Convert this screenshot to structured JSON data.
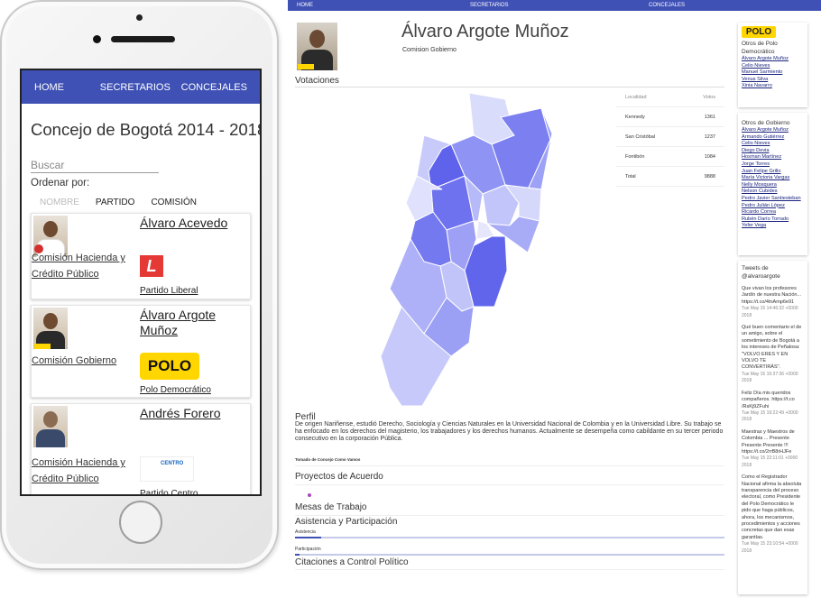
{
  "mobile": {
    "nav": [
      "HOME",
      "SECRETARIOS",
      "CONCEJALES"
    ],
    "title": "Concejo de Bogotá 2014 - 2018",
    "search_placeholder": "Buscar",
    "order_label": "Ordenar por:",
    "sort_options": [
      "NOMBRE",
      "PARTIDO",
      "COMISIÓN"
    ],
    "cards": [
      {
        "name": "Álvaro Acevedo",
        "commission": "Comisión Hacienda y Crédito Público",
        "party": "Partido Liberal",
        "logo": "L"
      },
      {
        "name": "Álvaro Argote Muñoz",
        "commission": "Comisión Gobierno",
        "party": "Polo Democrático",
        "logo": "POLO"
      },
      {
        "name": "Andrés Forero",
        "commission": "Comisión Hacienda y Crédito Público",
        "party": "Partido Centro",
        "logo": "CENTRO"
      }
    ]
  },
  "desktop": {
    "nav": [
      "HOME",
      "SECRETARIOS",
      "CONCEJALES"
    ],
    "name": "Álvaro Argote Muñoz",
    "commission": "Comision Gobierno",
    "votes_title": "Votaciones",
    "votes_table": {
      "headers": [
        "Localidad",
        "Votos"
      ],
      "rows": [
        [
          "Kennedy",
          "1361"
        ],
        [
          "San Cristóbal",
          "1237"
        ],
        [
          "Fontibón",
          "1084"
        ],
        [
          "Total",
          "9888"
        ]
      ]
    },
    "perfil_title": "Perfil",
    "perfil_text": "De origen Nariñense, estudió Derecho, Sociología y Ciencias Naturales en la Universidad Nacional de Colombia y en la Universidad Libre. Su trabajo se ha enfocado en los derechos del magisterio, los trabajadores y los derechos humanos. Actualmente se desempeña como cabildante en su tercer periodo consecutivo en la corporación Pública.",
    "source": "Tomado de Concejo Como Vamos",
    "proyectos": "Proyectos de Acuerdo",
    "mesas": "Mesas de Trabajo",
    "asistencia_title": "Asistencia y Participación",
    "asistencia_label": "Asistencia",
    "asistencia_value": 0.06,
    "participacion_label": "Participación",
    "participacion_value": 0.01,
    "citaciones": "Citaciones a Control Político"
  },
  "sidebar": {
    "party_logo": "POLO",
    "party_title": "Otros de Polo Democrático",
    "party_members": [
      "Álvaro Argote Muñoz",
      "Celio Nieves",
      "Manuel Sarmiento",
      "Venus Silva",
      "Xinia Navarro"
    ],
    "commission_title": "Otros de Gobierno",
    "commission_members": [
      "Álvaro Argote Muñoz",
      "Armando Gutiérrez",
      "Celio Nieves",
      "Diego Devia",
      "Hosman Martínez",
      "Jorge Torres",
      "Juan Felipe Grillo",
      "María Victoria Vargas",
      "Nelly Mosquera",
      "Nelson Cubides",
      "Pedro Javier Santiesteban",
      "Pedro Julián López",
      "Ricardo Correa",
      "Rubén Darío Torrado",
      "Yefer Vega"
    ],
    "tweets_title": "Tweets de @alvaroargote",
    "tweets": [
      {
        "text": "Que vivan los profesores Jardín de nuestra Nación... https://t.co/4tnAmp6e91",
        "date": "Tue May 15 14:46:32 +0000 2018"
      },
      {
        "text": "Qué buen comentario el de un amigo, sobre el sometimiento de Bogotá a los intereses de Peñalosa: \"VOLVO ERES Y EN VOLVO TE CONVERTIRÁS\".",
        "date": "Tue May 15 16:37:36 +0000 2018"
      },
      {
        "text": "Feliz Día mis queridos compañeros. https://t.co /RsKj9ZFuhi",
        "date": "Tue May 15 19:22:49 +0000 2018"
      },
      {
        "text": "Maestras y Maestros de Colombia ... Presente Presente Presente !!! https://t.co/2rrB8rHJFe",
        "date": "Tue May 15 22:11:01 +0000 2018"
      },
      {
        "text": "Como el Registrador Nacional afirma la absoluta transparencia del proceso electoral, como Presidente del Polo Democrático le pido que haga públicos, ahora, los mecanismos, procedimientos y acciones concretas que dan esas garantías.",
        "date": "Tue May 15 23:10:54 +0000 2018"
      }
    ]
  }
}
